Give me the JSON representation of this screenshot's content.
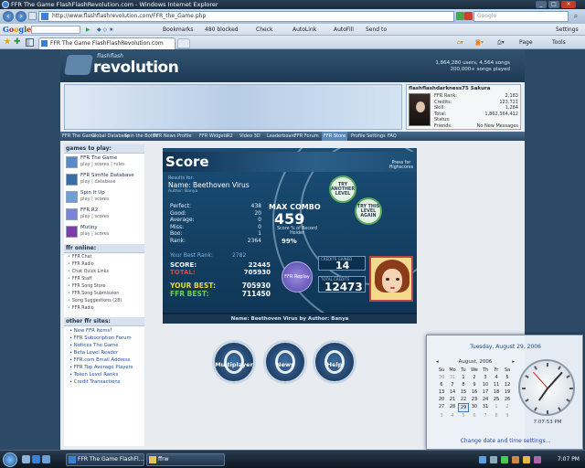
{
  "window": {
    "title": "FFR The Game FlashFlashRevolution.com - Windows Internet Explorer"
  },
  "address": {
    "url": "http://www.flashflashrevolution.com/FFR_the_Game.php",
    "search_placeholder": "Google"
  },
  "google_toolbar": {
    "bookmarks": "Bookmarks",
    "blocked": "480 blocked",
    "check": "Check",
    "autolink": "AutoLink",
    "autofill": "AutoFill",
    "send_to": "Send to",
    "settings": "Settings"
  },
  "tab": {
    "title": "FFR The Game FlashFlashRevolution.com"
  },
  "command_bar": {
    "page": "Page",
    "tools": "Tools"
  },
  "site": {
    "logo_small": "flashflash",
    "logo_big": "revolution",
    "stats_line1": "1,864,280 users, 4,564 songs",
    "stats_line2": "200,000+ songs played"
  },
  "profile": {
    "name": "flashflashdarkness75 Sakura",
    "rows": [
      {
        "label": "FFR Rank:",
        "value": "2,183"
      },
      {
        "label": "Credits:",
        "value": "123,721"
      },
      {
        "label": "Skill:",
        "value": "1,284"
      },
      {
        "label": "Total:",
        "value": "1,862,364,412"
      },
      {
        "label": "Status:",
        "value": ""
      },
      {
        "label": "Friends:",
        "value": "No New Messages"
      }
    ]
  },
  "nav": [
    "FFR The Game",
    "Global Database",
    "Spin the Bottle",
    "FFR News",
    "Profile",
    "FFR Widgets",
    "R2",
    "Video 3D",
    "Leaderboard",
    "FFR Forum",
    "FFR Store",
    "Profile Settings",
    "FAQ"
  ],
  "sidebar": {
    "games_title": "games to play:",
    "games": [
      {
        "name": "FFR The Game",
        "sub": "play | scores | rules",
        "color": "#5a8bc4"
      },
      {
        "name": "FFR Simfile Database",
        "sub": "play | database",
        "color": "#3a6da8"
      },
      {
        "name": "Spin It Up",
        "sub": "play | scores",
        "color": "#6fa0d3"
      },
      {
        "name": "FFR R2",
        "sub": "play | scores",
        "color": "#7b84d6"
      },
      {
        "name": "Mutiny",
        "sub": "play | scores",
        "color": "#7d3da8"
      }
    ],
    "ffr_title": "ffr online:",
    "ffr_items": [
      "FFR Chat",
      "FFR Radio",
      "Chat Quick Links",
      "FFR Staff",
      "FFR Song Store",
      "FFR Song Submission",
      "Song Suggestions (28)",
      "FFR Radio"
    ],
    "other_title": "other ffr sites:",
    "other_items": [
      "New FFR Items!",
      "FFR Subscription Forum",
      "Notices The Game",
      "Beta Level Reader",
      "FFR.com Email Address",
      "FFR Top Average Players",
      "Token Level Ranks",
      "Credit Transactions"
    ]
  },
  "score": {
    "title": "Score",
    "song_label": "Results for:",
    "song_name": "Name: Beethoven Virus",
    "author_line": "Author: Banya",
    "press_hint": "Press for Highscores",
    "try_another": "TRY ANOTHER LEVEL",
    "try_same": "TRY THIS LEVEL AGAIN",
    "judgements": [
      {
        "label": "Perfect:",
        "value": "438"
      },
      {
        "label": "Good:",
        "value": "20"
      },
      {
        "label": "Average:",
        "value": "0"
      },
      {
        "label": "Miss:",
        "value": "0"
      },
      {
        "label": "Boo:",
        "value": "1"
      },
      {
        "label": "Rank:",
        "value": "2364"
      }
    ],
    "max_combo_label": "MAX COMBO",
    "max_combo": "459",
    "combo_note": "Score % of Record Holder",
    "combo_pct": "99%",
    "best_rank_label": "Your Best Rank:",
    "best_rank": "2782",
    "score_label": "SCORE:",
    "score_value": "22445",
    "total_label": "TOTAL:",
    "total_value": "705930",
    "your_best_label": "YOUR BEST:",
    "your_best_value": "705930",
    "ffr_best_label": "FFR BEST:",
    "ffr_best_value": "711450",
    "credits_label": "CREDITS GAINED",
    "credits_value": "14",
    "total_credits_label": "TOTAL CREDITS",
    "total_credits_value": "12473",
    "replay_label": "FFR Replay",
    "bottom_line": "Name: Beethoven Virus by Author: Banya"
  },
  "big_buttons": [
    "Multiplayer",
    "News",
    "Help"
  ],
  "clock": {
    "date_line": "Tuesday, August 29, 2006",
    "month": "August, 2006",
    "weekdays": [
      "Su",
      "Mo",
      "Tu",
      "We",
      "Th",
      "Fr",
      "Sa"
    ],
    "days": [
      "30",
      "31",
      "1",
      "2",
      "3",
      "4",
      "5",
      "6",
      "7",
      "8",
      "9",
      "10",
      "11",
      "12",
      "13",
      "14",
      "15",
      "16",
      "17",
      "18",
      "19",
      "20",
      "21",
      "22",
      "23",
      "24",
      "25",
      "26",
      "27",
      "28",
      "29",
      "30",
      "31",
      "1",
      "2",
      "3",
      "4",
      "5",
      "6",
      "7",
      "8",
      "9"
    ],
    "today": "29",
    "time": "7:07:53 PM",
    "link": "Change date and time settings..."
  },
  "taskbar": {
    "tasks": [
      "FFR The Game FlashFl...",
      "ffrw"
    ],
    "time": "7:07 PM"
  }
}
